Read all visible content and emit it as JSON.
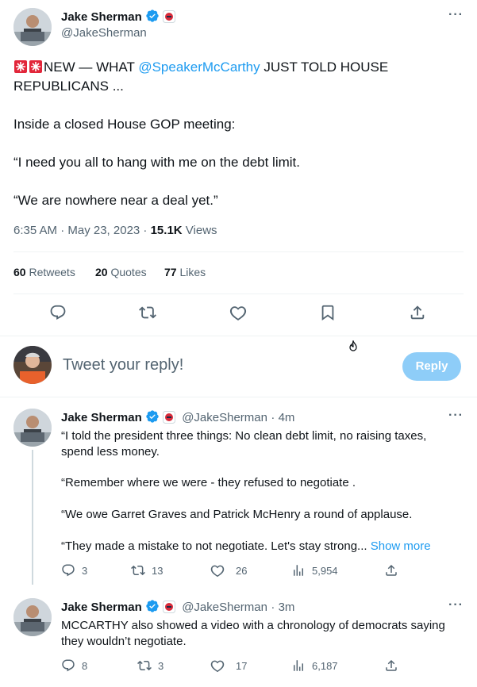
{
  "main_tweet": {
    "author_name": "Jake Sherman",
    "author_handle": "@JakeSherman",
    "text_prefix": "NEW — WHAT ",
    "mention": "@SpeakerMcCarthy",
    "text_line1_rest": " JUST TOLD HOUSE",
    "text_line2": "REPUBLICANS ...",
    "para2": "Inside a closed House GOP meeting:",
    "para3": "“I need you all to hang with me on the debt limit.",
    "para4": "“We are nowhere near a deal yet.”",
    "time": "6:35 AM · May 23, 2023 · ",
    "views_count": "15.1K",
    "views_label": " Views",
    "retweets_count": "60",
    "retweets_label": " Retweets",
    "quotes_count": "20",
    "quotes_label": " Quotes",
    "likes_count": "77",
    "likes_label": " Likes"
  },
  "composer": {
    "placeholder": "Tweet your reply!",
    "reply_button": "Reply"
  },
  "replies": [
    {
      "author_name": "Jake Sherman",
      "author_handle": "@JakeSherman",
      "time": "· 4m",
      "line1": "“I told the president three things: No clean debt limit, no raising taxes,",
      "line2": "spend less money.",
      "line3": "“Remember where we were - they refused to negotiate .",
      "line4": "“We owe Garret Graves and Patrick McHenry a round of applause.",
      "line5": "“They made a mistake to not negotiate. Let's stay strong...",
      "show_more": "Show more",
      "replies_count": "3",
      "retweets_count": "13",
      "likes_count": "26",
      "views_count": "5,954"
    },
    {
      "author_name": "Jake Sherman",
      "author_handle": "@JakeSherman",
      "time": "· 3m",
      "line1": "MCCARTHY also showed a video with a chronology of democrats saying",
      "line2": "they wouldn’t negotiate.",
      "replies_count": "8",
      "retweets_count": "3",
      "likes_count": "17",
      "views_count": "6,187"
    }
  ],
  "icons": {
    "verified": "verified-badge-icon",
    "affiliate": "politico-badge-icon",
    "siren": "siren-emoji-icon",
    "reply": "reply-icon",
    "retweet": "retweet-icon",
    "like": "heart-icon",
    "bookmark": "bookmark-icon",
    "share": "share-icon",
    "views": "views-icon",
    "more": "more-icon"
  },
  "colors": {
    "accent": "#1d9bf0",
    "reply_button_disabled": "#8ecdf8",
    "secondary_text": "#536471"
  }
}
